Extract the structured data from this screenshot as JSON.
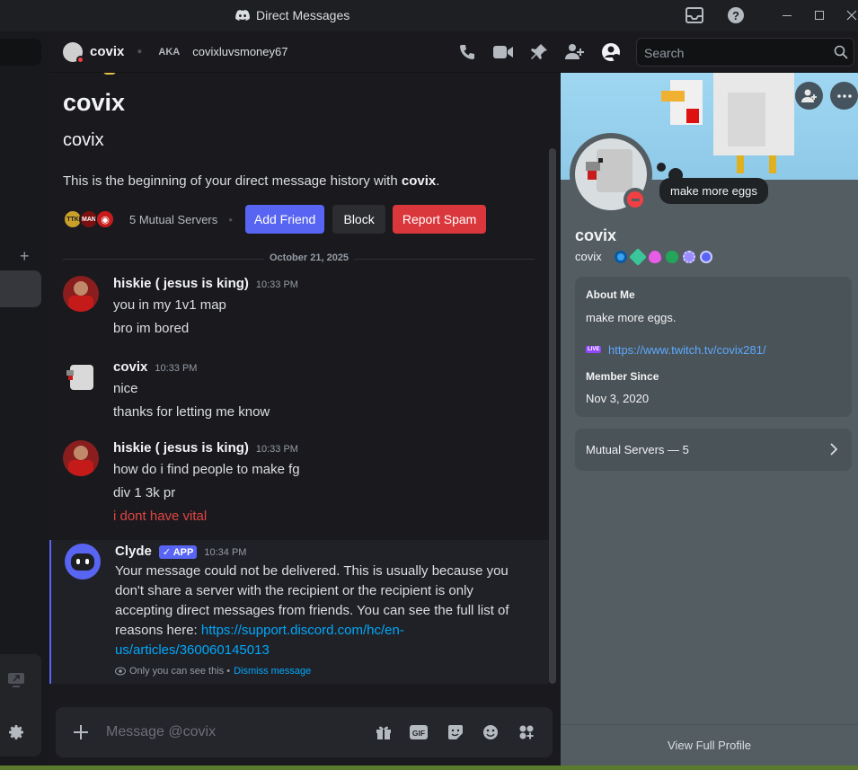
{
  "window": {
    "title": "Direct Messages"
  },
  "header": {
    "username": "covix",
    "aka_label": "AKA",
    "aka_value": "covixluvsmoney67",
    "search_placeholder": "Search"
  },
  "intro": {
    "big_name": "covix",
    "sub_name": "covix",
    "text_prefix": "This is the beginning of your direct message history with ",
    "text_name": "covix",
    "text_suffix": ".",
    "mutual_servers": "5 Mutual Servers",
    "add_friend": "Add Friend",
    "block": "Block",
    "report_spam": "Report Spam",
    "server_icons": [
      "TTK",
      "MAN",
      "◉"
    ]
  },
  "date_divider": "October 21, 2025",
  "messages": [
    {
      "author": "hiskie ( jesus is king)",
      "time": "10:33 PM",
      "lines": [
        "you in my 1v1 map",
        "bro im bored"
      ]
    },
    {
      "author": "covix",
      "time": "10:33 PM",
      "lines": [
        "nice",
        "thanks for letting me know"
      ]
    },
    {
      "author": "hiskie ( jesus is king)",
      "time": "10:33 PM",
      "lines": [
        "how do i find people to make fg",
        "div 1 3k pr",
        "i dont have vital"
      ]
    }
  ],
  "clyde": {
    "author": "Clyde",
    "badge": "APP",
    "time": "10:34 PM",
    "text": "Your message could not be delivered. This is usually because you don't share a server with the recipient or the recipient is only accepting direct messages from friends. You can see the full list of reasons here: ",
    "link": "https://support.discord.com/hc/en-us/articles/360060145013",
    "link_line1": "https://support.discord.com/hc/en-",
    "link_line2": "us/articles/360060145013",
    "only_you": "Only you can see this •",
    "dismiss": "Dismiss message"
  },
  "composer": {
    "placeholder": "Message @covix"
  },
  "profile": {
    "display_name": "covix",
    "username": "covix",
    "status": "make more eggs",
    "about_me_label": "About Me",
    "about_me": "make more eggs.",
    "twitch_link": "https://www.twitch.tv/covix281/",
    "member_since_label": "Member Since",
    "member_since": "Nov 3, 2020",
    "mutual_servers": "Mutual Servers — 5",
    "view_full": "View Full Profile",
    "live_tag": "LIVE"
  },
  "colors": {
    "accent": "#5865f2",
    "danger": "#da373c",
    "link": "#00a8fc",
    "red_text": "#e04444",
    "profile_bg": "#545e62"
  }
}
